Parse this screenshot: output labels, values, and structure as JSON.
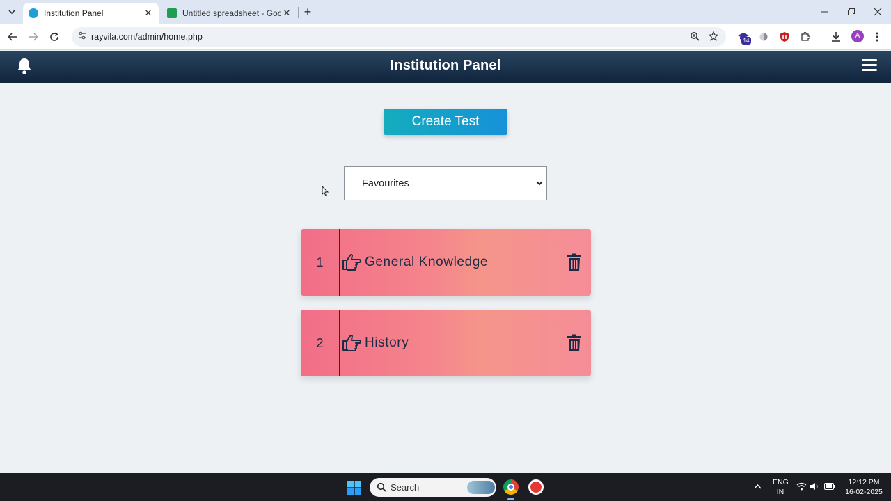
{
  "browser": {
    "tabs": [
      {
        "title": "Institution Panel",
        "active": true
      },
      {
        "title": "Untitled spreadsheet - Google S",
        "active": false
      }
    ],
    "url": "rayvila.com/admin/home.php",
    "extension_badge": "14",
    "profile_initial": "A"
  },
  "app": {
    "title": "Institution Panel",
    "create_button_label": "Create Test",
    "filter": {
      "selected": "Favourites"
    },
    "tests": [
      {
        "number": "1",
        "name": "General Knowledge"
      },
      {
        "number": "2",
        "name": "History"
      }
    ]
  },
  "taskbar": {
    "search_placeholder": "Search",
    "language_line1": "ENG",
    "language_line2": "IN",
    "time": "12:12 PM",
    "date": "16-02-2025"
  },
  "colors": {
    "header_dark": "#10243c",
    "create_button": "#1691d8",
    "card_pink": "#f26e87",
    "card_peach": "#f5958a",
    "icon_navy": "#1d2b46"
  }
}
